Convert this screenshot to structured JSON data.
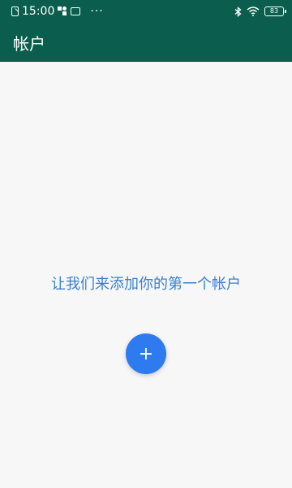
{
  "status_bar": {
    "time": "15:00",
    "overflow": "···",
    "battery": "83"
  },
  "app_bar": {
    "title": "帐户"
  },
  "empty_state": {
    "message": "让我们来添加你的第一个帐户"
  },
  "fab": {
    "label": "+",
    "icon": "plus-icon"
  },
  "colors": {
    "primary": "#0b5e4d",
    "accent": "#2e7bf0",
    "message": "#3a7fd1",
    "background": "#f7f7f7"
  }
}
